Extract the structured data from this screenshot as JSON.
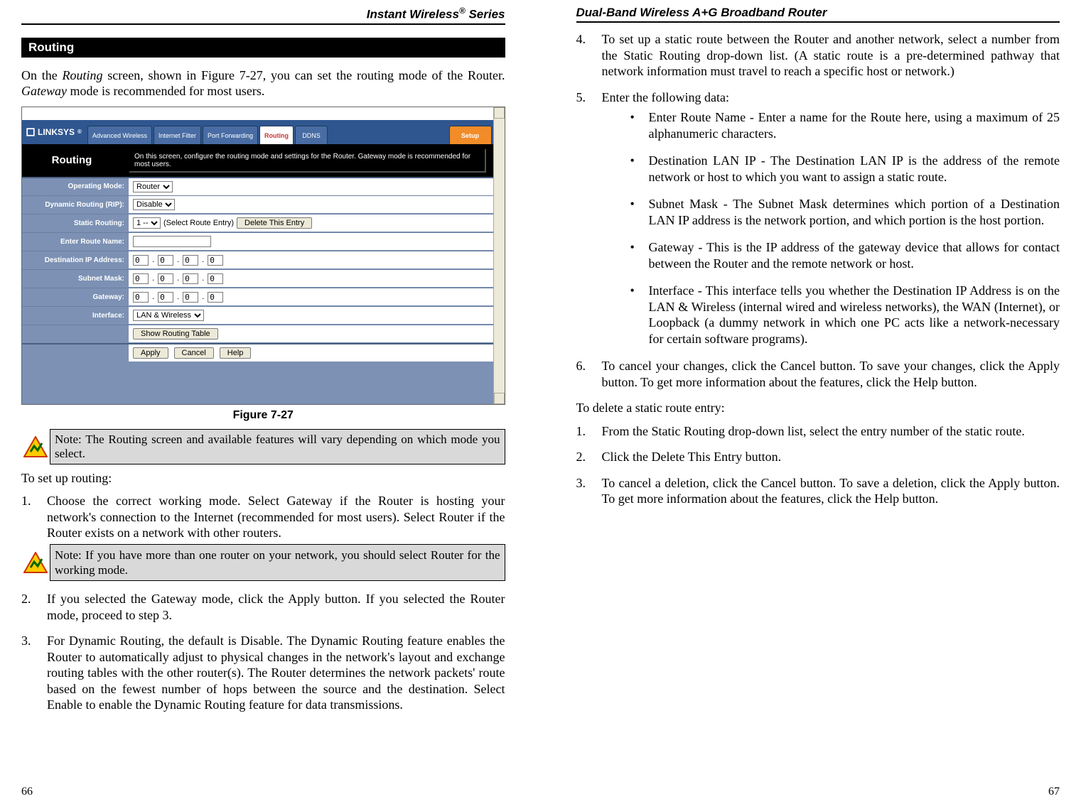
{
  "left": {
    "header_pre": "Instant Wireless",
    "header_post": " Series",
    "section_title": "Routing",
    "intro1": "On the ",
    "intro_em1": "Routing",
    "intro2": " screen, shown in Figure 7-27, you can set the routing mode of the Router. ",
    "intro_em2": "Gateway",
    "intro3": " mode is recommended for most users.",
    "figure_caption": "Figure 7-27",
    "note1_label": "Note:",
    "note1_a": " The ",
    "note1_em": "Routing",
    "note1_b": " screen and available features will vary depending on which mode you select.",
    "setup_intro": "To set up routing:",
    "step1_a": "Choose the correct working mode. Select ",
    "step1_b1": "Gateway",
    "step1_c": " if the Router is hosting your network's connection to the Internet (recommended for most users). Select ",
    "step1_b2": "Router",
    "step1_d": " if the Router exists on a network with other routers.",
    "note2_label": "Note:",
    "note2_a": " If you have more than one router on your network, you should select ",
    "note2_b": "Router",
    "note2_c": " for the working mode.",
    "step2_a": "If you selected the ",
    "step2_em1": "Gateway",
    "step2_b": " mode, click the ",
    "step2_bold": "Apply",
    "step2_c": " button. If you selected the ",
    "step2_em2": "Router",
    "step2_d": " mode, proceed to step 3.",
    "step3_a": "For ",
    "step3_em": "Dynamic Routing",
    "step3_b": ", the default is ",
    "step3_bold1": "Disable",
    "step3_c": ". The Dynamic Routing feature enables the Router to automatically adjust to physical changes in the network's layout and exchange routing tables with the other router(s). The Router determines the network packets' route based on the fewest number of hops between the source and the destination. Select ",
    "step3_bold2": "Enable",
    "step3_d": " to enable the Dynamic Routing feature for data transmissions.",
    "pagenum": "66"
  },
  "right": {
    "header": "Dual-Band Wireless A+G Broadband Router",
    "step4_a": "To set up a static route between the Router and another network, select a number from the ",
    "step4_em": "Static Routing",
    "step4_b": " drop-down list. (A static route is a pre-determined pathway that network information must travel to reach a specific host or network.)",
    "step5": "Enter the following data:",
    "b1_b": "Enter Route Name - ",
    "b1_t": "Enter a name for the Route here, using a maximum of 25 alphanumeric characters.",
    "b2_b": "Destination LAN IP - ",
    "b2_t": "The Destination LAN IP is the address of the remote network or host to which you want to assign a static route.",
    "b3_b": "Subnet Mask - ",
    "b3_t": "The Subnet Mask determines which portion of a Destination LAN IP address is the network portion, and which portion is the host portion.",
    "b4_b": "Gateway - ",
    "b4_t": "This is the IP address of the gateway device that allows for contact between the Router and the remote network or host.",
    "b5_b": "Interface",
    "b5_t1": " - This interface tells you whether the Destination IP Address is on the ",
    "b5_t2": "LAN & Wireless",
    "b5_t3": " (internal wired and wireless networks), the ",
    "b5_t4": "WAN",
    "b5_t5": " (Internet), or ",
    "b5_t6": "Loopback",
    "b5_t7": " (a dummy network in which one PC acts like a network-necessary for certain software programs).",
    "step6_a": "To cancel your changes, click the ",
    "step6_b1": "Cancel",
    "step6_b": " button. To save your changes, click the ",
    "step6_b2": "Apply",
    "step6_c": " button. To get more information about the features, click the ",
    "step6_b3": "Help",
    "step6_d": " button.",
    "del_intro": "To delete a static route entry:",
    "d1_a": "From the ",
    "d1_em": "Static Routing",
    "d1_b": " drop-down list, select the entry number of the static route.",
    "d2_a": "Click the ",
    "d2_b": "Delete This Entry",
    "d2_c": " button.",
    "d3_a": "To cancel a deletion, click the ",
    "d3_b1": "Cancel",
    "d3_b": " button. To save a deletion, click the ",
    "d3_b2": "Apply",
    "d3_c": " button. To get more information about the features, click the ",
    "d3_b3": "Help",
    "d3_d": " button.",
    "pagenum": "67"
  },
  "shot": {
    "logo": "LINKSYS",
    "tabs": {
      "adv": "Advanced\nWireless",
      "filter": "Internet\nFilter",
      "pf": "Port\nForwarding",
      "routing": "Routing",
      "ddns": "DDNS",
      "setup": "Setup"
    },
    "title": "Routing",
    "desc": "On this screen, configure the routing mode and settings for the Router. Gateway mode is recommended for most users.",
    "labels": {
      "mode": "Operating Mode:",
      "rip": "Dynamic Routing (RIP):",
      "static": "Static Routing:",
      "route_name": "Enter Route Name:",
      "dest": "Destination IP Address:",
      "mask": "Subnet Mask:",
      "gw": "Gateway:",
      "iface": "Interface:"
    },
    "vals": {
      "mode": "Router",
      "rip": "Disable",
      "static": "1 --",
      "static_hint": "(Select Route Entry)",
      "delete": "Delete This Entry",
      "oct": "0",
      "iface": "LAN & Wireless",
      "show": "Show Routing Table",
      "apply": "Apply",
      "cancel": "Cancel",
      "help": "Help"
    }
  }
}
